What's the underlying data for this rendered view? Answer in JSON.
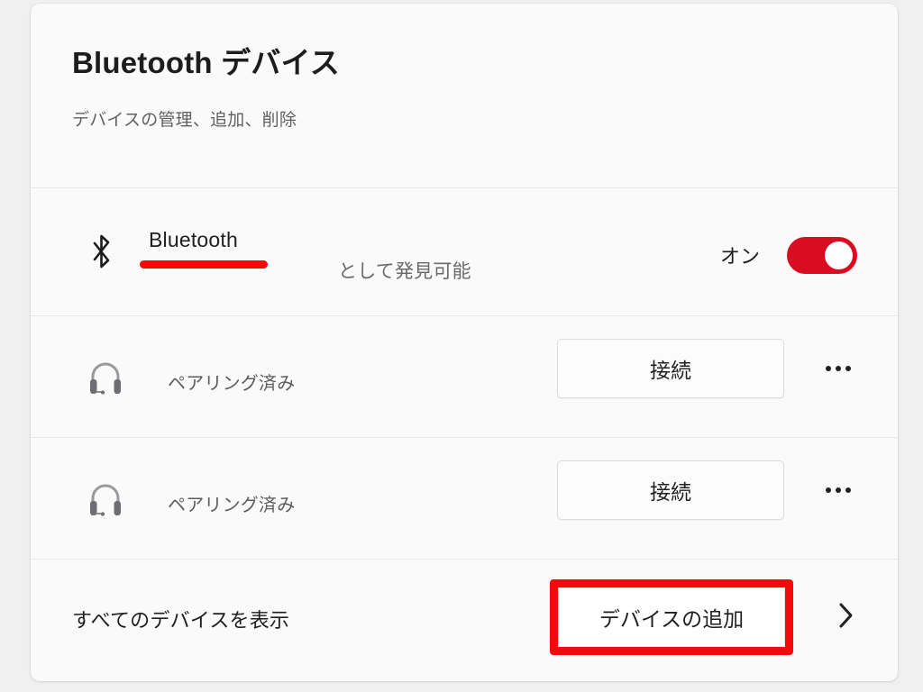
{
  "header": {
    "title": "Bluetooth デバイス",
    "subtitle": "デバイスの管理、追加、削除"
  },
  "bluetooth_row": {
    "icon": "bluetooth-icon",
    "label": "Bluetooth",
    "discoverable_text": "として発見可能",
    "toggle_state_label": "オン",
    "toggle_on": true,
    "annotation_color": "#f40a0a",
    "toggle_color": "#d90d22"
  },
  "devices": [
    {
      "icon": "headset-icon",
      "name": "",
      "status": "ペアリング済み",
      "connect_label": "接続",
      "more_label": "..."
    },
    {
      "icon": "headset-icon",
      "name": "",
      "status": "ペアリング済み",
      "connect_label": "接続",
      "more_label": "..."
    }
  ],
  "footer": {
    "show_all_label": "すべてのデバイスを表示",
    "add_device_label": "デバイスの追加",
    "chevron": "chevron-right-icon",
    "annotation_color": "#f40a0a"
  }
}
